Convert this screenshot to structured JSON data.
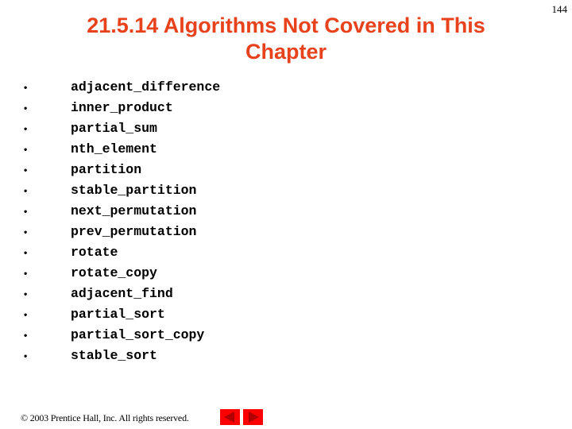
{
  "page_number": "144",
  "title": "21.5.14 Algorithms Not Covered in This Chapter",
  "bullet_glyph": "•",
  "items": [
    "adjacent_difference",
    "inner_product",
    "partial_sum",
    "nth_element",
    "partition",
    "stable_partition",
    "next_permutation",
    "prev_permutation",
    "rotate",
    "rotate_copy",
    "adjacent_find",
    "partial_sort",
    "partial_sort_copy",
    "stable_sort"
  ],
  "footer": {
    "copyright": "© 2003 Prentice Hall, Inc.  All rights reserved."
  },
  "nav": {
    "prev_icon": "triangle-left-icon",
    "next_icon": "triangle-right-icon",
    "button_color": "#ff0000",
    "arrow_color": "#b00000"
  },
  "colors": {
    "title": "#e8421c"
  }
}
